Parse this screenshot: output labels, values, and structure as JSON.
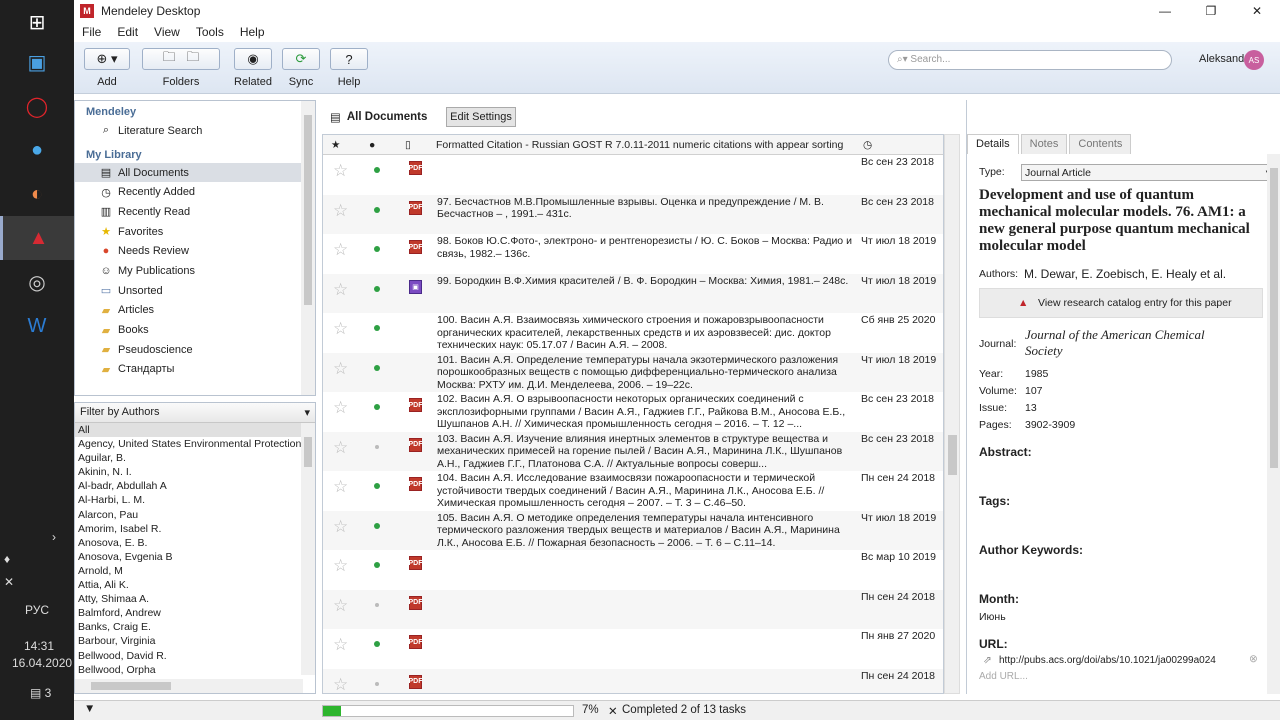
{
  "taskbar": {
    "language": "РУС",
    "time": "14:31",
    "date": "16.04.2020",
    "notification_count": "3"
  },
  "window": {
    "title": "Mendeley Desktop",
    "logo_text": "M"
  },
  "menu": [
    "File",
    "Edit",
    "View",
    "Tools",
    "Help"
  ],
  "toolbar": {
    "add": "Add",
    "folders": "Folders",
    "related": "Related",
    "sync": "Sync",
    "help": "Help",
    "search_placeholder": "Search...",
    "user": "Aleksandr",
    "avatar_initials": "AS"
  },
  "sidebar": {
    "mendeley_heading": "Mendeley",
    "literature_search": "Literature Search",
    "library_heading": "My Library",
    "items": [
      {
        "label": "All Documents",
        "icon": "documents-icon"
      },
      {
        "label": "Recently Added",
        "icon": "clock-icon"
      },
      {
        "label": "Recently Read",
        "icon": "book-icon"
      },
      {
        "label": "Favorites",
        "icon": "star-icon"
      },
      {
        "label": "Needs Review",
        "icon": "review-icon"
      },
      {
        "label": "My Publications",
        "icon": "person-icon"
      },
      {
        "label": "Unsorted",
        "icon": "tray-icon"
      },
      {
        "label": "Articles",
        "icon": "folder-icon"
      },
      {
        "label": "Books",
        "icon": "folder-icon"
      },
      {
        "label": "Pseudoscience",
        "icon": "folder-icon"
      },
      {
        "label": "Стандарты",
        "icon": "folder-icon"
      }
    ]
  },
  "filter": {
    "heading": "Filter by Authors",
    "authors": [
      "All",
      "Agency, United States Environmental Protection",
      "Aguilar, B.",
      "Akinin, N. I.",
      "Al-badr, Abdullah A",
      "Al-Harbi, L. M.",
      "Alarcon, Pau",
      "Amorim, Isabel R.",
      "Anosova, E. B.",
      "Anosova, Evgenia B",
      "Arnold, M",
      "Attia, Ali K.",
      "Atty, Shimaa A.",
      "Balmford, Andrew",
      "Banks, Craig E.",
      "Barbour, Virginia",
      "Bellwood, David R.",
      "Bellwood, Orpha"
    ]
  },
  "documents": {
    "heading": "All Documents",
    "edit_settings": "Edit Settings",
    "citation_column": "Formatted Citation - Russian GOST R 7.0.11-2011 numeric citations with appear sorting",
    "rows": [
      {
        "cite": "",
        "date": "Вс сен 23 2018",
        "pdf": true,
        "read": true
      },
      {
        "cite": "97. Бесчастнов М.В.Промышленные взрывы. Оценка и предупреждение / М. В. Бесчастнов – , 1991.– 431с.",
        "date": "Вс сен 23 2018",
        "pdf": true,
        "read": true
      },
      {
        "cite": "98. Боков Ю.С.Фото-, электроно- и рентгенорезисты / Ю. С. Боков – Москва: Радио и связь, 1982.– 136с.",
        "date": "Чт июл 18 2019",
        "pdf": true,
        "read": true
      },
      {
        "cite": "99. Бородкин В.Ф.Химия красителей / В. Ф. Бородкин – Москва: Химия, 1981.– 248с.",
        "date": "Чт июл 18 2019",
        "pdf": "other",
        "read": true
      },
      {
        "cite": "100. Васин А.Я. Взаимосвязь химического строения и пожаровзрывоопасности органических красителей, лекарственных средств и их аэровзвесей: дис. доктор технических наук: 05.17.07 / Васин А.Я. – 2008.",
        "date": "Сб янв 25 2020",
        "pdf": false,
        "read": true
      },
      {
        "cite": "101. Васин А.Я. Определение температуры начала экзотермического разложения порошкообразных веществ с помощью дифференциально-термического анализа Москва: РХТУ им. Д.И. Менделеева, 2006. – 19–22с.",
        "date": "Чт июл 18 2019",
        "pdf": false,
        "read": true
      },
      {
        "cite": "102. Васин А.Я. О взрывоопасности некоторых органических соединений с эксплозифорными группами / Васин А.Я., Гаджиев Г.Г., Райкова В.М., Аносова Е.Б., Шушпанов А.Н. // Химическая промышленность сегодня – 2016. – Т. 12 –...",
        "date": "Вс сен 23 2018",
        "pdf": true,
        "read": true
      },
      {
        "cite": "103. Васин А.Я. Изучение влияния инертных элементов в структуре вещества и механических примесей на горение пылей / Васин А.Я., Маринина Л.К., Шушпанов А.Н., Гаджиев Г.Г., Платонова С.А. // Актуальные вопросы соверш...",
        "date": "Вс сен 23 2018",
        "pdf": true,
        "read": false
      },
      {
        "cite": "104. Васин А.Я. Исследование взаимосвязи пожароопасности и термической устойчивости твердых соединений / Васин А.Я., Маринина Л.К., Аносова Е.Б. // Химическая промышленность сегодня – 2007. – Т. 3 – С.46–50.",
        "date": "Пн сен 24 2018",
        "pdf": true,
        "read": true
      },
      {
        "cite": "105. Васин А.Я. О методике определения температуры начала интенсивного термического разложения твердых веществ и материалов / Васин А.Я., Маринина Л.К., Аносова Е.Б. // Пожарная безопасность – 2006. – Т. 6 – С.11–14.",
        "date": "Чт июл 18 2019",
        "pdf": false,
        "read": true
      },
      {
        "cite": "",
        "date": "Вс мар 10 2019",
        "pdf": true,
        "read": true
      },
      {
        "cite": "",
        "date": "Пн сен 24 2018",
        "pdf": true,
        "read": false
      },
      {
        "cite": "",
        "date": "Пн янв 27 2020",
        "pdf": true,
        "read": true
      },
      {
        "cite": "",
        "date": "Пн сен 24 2018",
        "pdf": true,
        "read": false
      }
    ]
  },
  "details": {
    "tabs": [
      "Details",
      "Notes",
      "Contents"
    ],
    "type_label": "Type:",
    "type_value": "Journal Article",
    "title": "Development and use of quantum mechanical molecular models. 76. AM1: a new general purpose quantum mechanical molecular model",
    "authors_label": "Authors:",
    "authors": "M. Dewar, E. Zoebisch, E. Healy et al.",
    "catalog_link": "View research catalog entry for this paper",
    "journal_label": "Journal:",
    "journal": "Journal of the American Chemical Society",
    "year_label": "Year:",
    "year": "1985",
    "volume_label": "Volume:",
    "volume": "107",
    "issue_label": "Issue:",
    "issue": "13",
    "pages_label": "Pages:",
    "pages": "3902-3909",
    "abstract_label": "Abstract:",
    "tags_label": "Tags:",
    "keywords_label": "Author Keywords:",
    "month_label": "Month:",
    "month": "Июнь",
    "url_label": "URL:",
    "url": "http://pubs.acs.org/doi/abs/10.1021/ja00299a024",
    "add_url": "Add URL..."
  },
  "status": {
    "progress_percent": 7,
    "progress_text": "7%",
    "tasks_text": "Completed 2 of 13 tasks"
  }
}
